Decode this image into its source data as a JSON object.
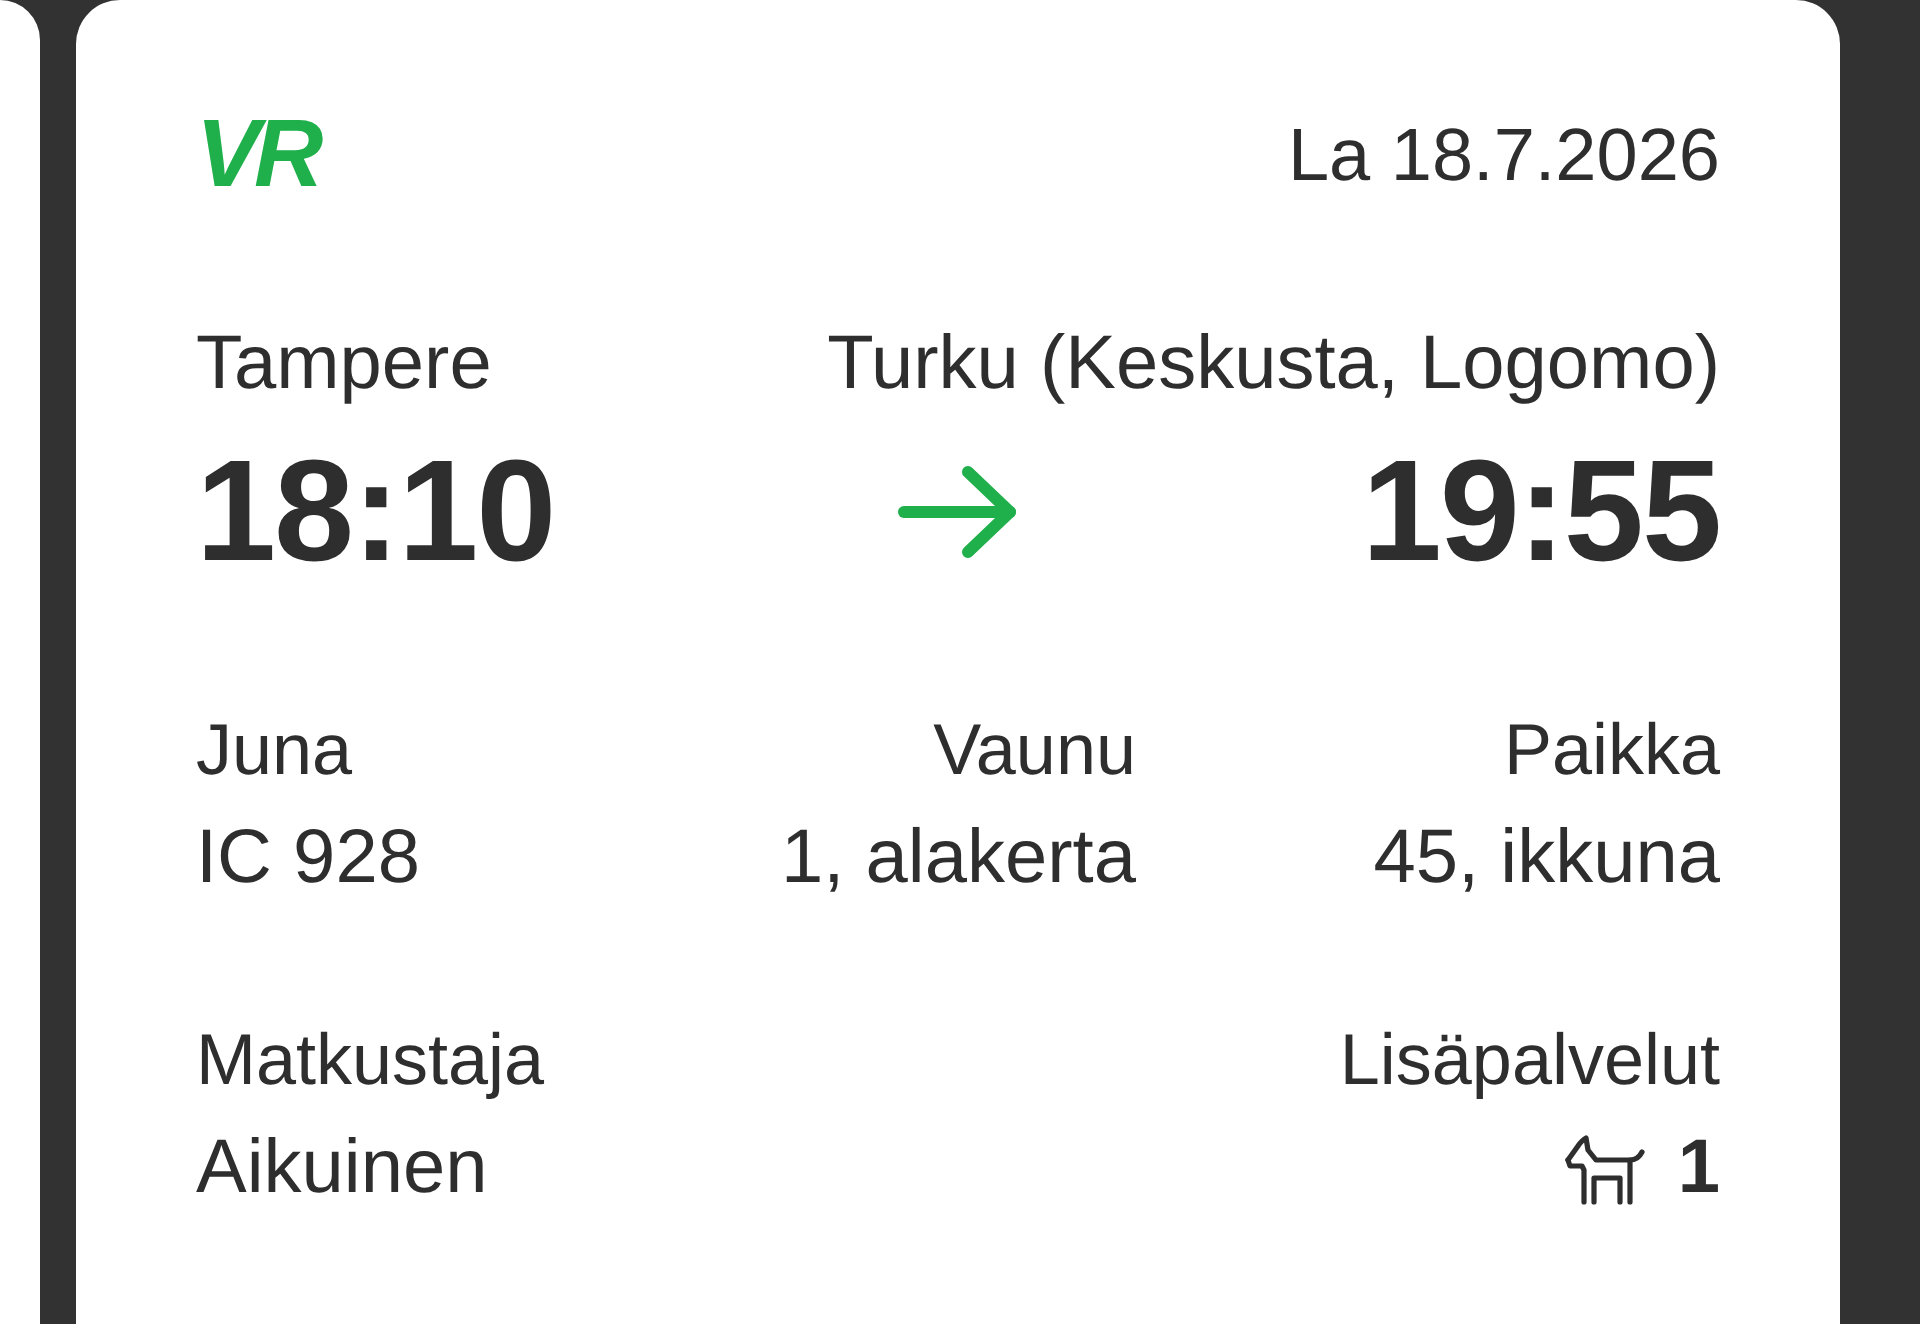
{
  "ticket": {
    "logo": "VR",
    "date": "La 18.7.2026",
    "departure": {
      "station": "Tampere",
      "time": "18:10"
    },
    "arrival": {
      "station": "Turku (Keskusta, Logomo)",
      "time": "19:55"
    },
    "details": [
      {
        "label": "Juna",
        "value": "IC 928"
      },
      {
        "label": "Vaunu",
        "value": "1, alakerta"
      },
      {
        "label": "Paikka",
        "value": "45, ikkuna"
      }
    ],
    "passenger": {
      "label": "Matkustaja",
      "value": "Aikuinen"
    },
    "extras": {
      "label": "Lisäpalvelut",
      "items": [
        {
          "kind": "pet",
          "count": "1"
        }
      ]
    }
  }
}
